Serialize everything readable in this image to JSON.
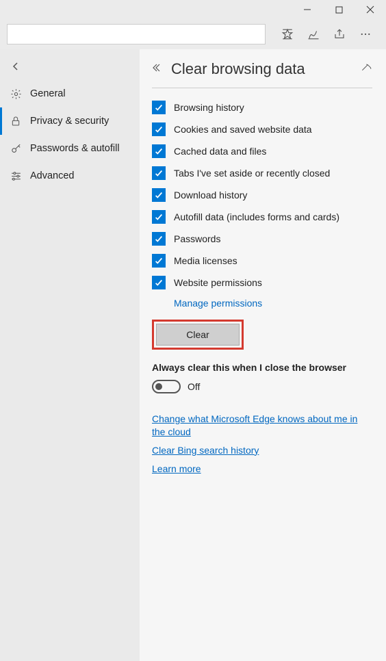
{
  "sidebar": {
    "items": [
      {
        "label": "General"
      },
      {
        "label": "Privacy & security"
      },
      {
        "label": "Passwords & autofill"
      },
      {
        "label": "Advanced"
      }
    ]
  },
  "panel": {
    "title": "Clear browsing data",
    "checkboxes": [
      "Browsing history",
      "Cookies and saved website data",
      "Cached data and files",
      "Tabs I've set aside or recently closed",
      "Download history",
      "Autofill data (includes forms and cards)",
      "Passwords",
      "Media licenses",
      "Website permissions"
    ],
    "managePermissions": "Manage permissions",
    "clearButton": "Clear",
    "alwaysClearHeading": "Always clear this when I close the browser",
    "toggleState": "Off",
    "links": {
      "cloud": "Change what Microsoft Edge knows about me in the cloud",
      "bing": "Clear Bing search history",
      "learn": "Learn more"
    }
  }
}
